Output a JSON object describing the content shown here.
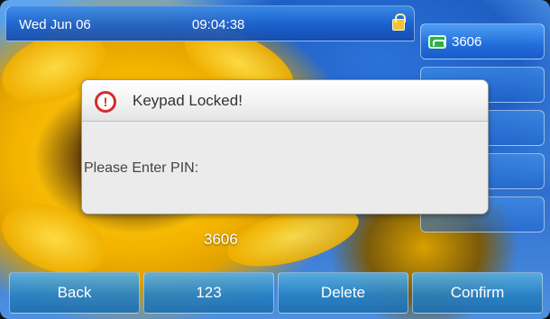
{
  "status_bar": {
    "date": "Wed Jun 06",
    "time": "09:04:38",
    "lock_icon": "lock-icon"
  },
  "line_keys": [
    {
      "label": "3606",
      "icon": "phone-icon"
    },
    {
      "label": ""
    },
    {
      "label": ""
    },
    {
      "label": ""
    },
    {
      "label": ""
    }
  ],
  "dialog": {
    "icon": "alert-icon",
    "icon_glyph": "!",
    "title": "Keypad Locked!",
    "prompt": "Please Enter PIN:"
  },
  "pin_entry": {
    "value": "3606"
  },
  "softkeys": {
    "back": "Back",
    "mode": "123",
    "delete": "Delete",
    "confirm": "Confirm"
  },
  "colors": {
    "accent_blue": "#1f5fc4",
    "alert_red": "#d92a2a",
    "lock_yellow": "#f1c232",
    "phone_green": "#2db04a"
  }
}
